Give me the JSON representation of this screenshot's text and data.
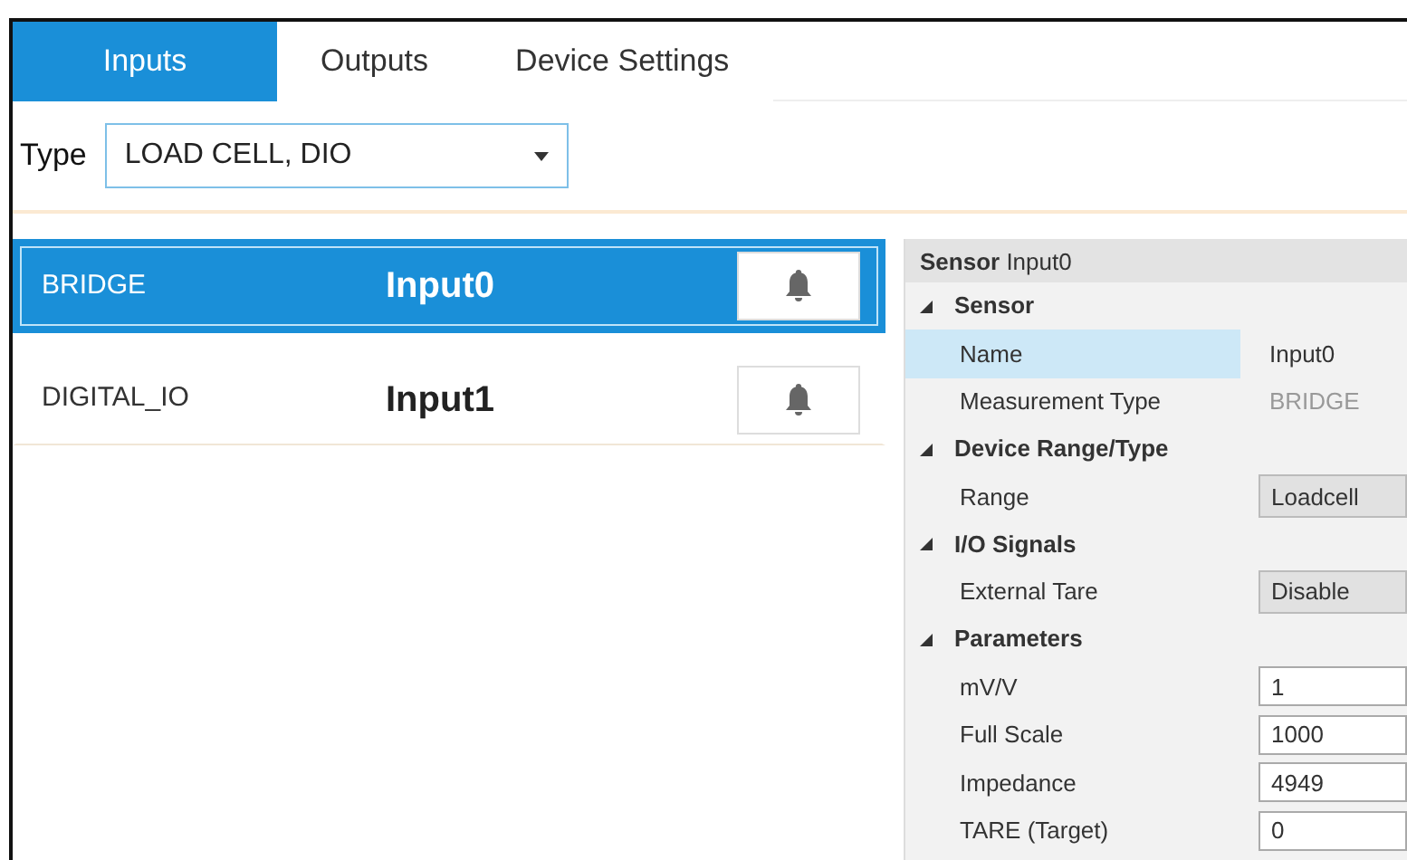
{
  "tabs": [
    {
      "label": "Inputs",
      "selected": true
    },
    {
      "label": "Outputs",
      "selected": false
    },
    {
      "label": "Device Settings",
      "selected": false
    }
  ],
  "type_filter": {
    "label": "Type",
    "value": "LOAD CELL, DIO"
  },
  "inputs": [
    {
      "type": "BRIDGE",
      "name": "Input0",
      "selected": true
    },
    {
      "type": "DIGITAL_IO",
      "name": "Input1",
      "selected": false
    }
  ],
  "properties": {
    "title": "**Sensor** Input0",
    "categories": [
      {
        "label": "Sensor",
        "expanded": true,
        "rows": [
          {
            "label": "Name",
            "value": "Input0",
            "kind": "text",
            "selected": true
          },
          {
            "label": "Measurement Type",
            "value": "BRIDGE",
            "kind": "readonly",
            "selected": false
          }
        ]
      },
      {
        "label": "Device Range/Type",
        "expanded": true,
        "rows": [
          {
            "label": "Range",
            "value": "Loadcell",
            "kind": "select",
            "selected": false
          }
        ]
      },
      {
        "label": "I/O Signals",
        "expanded": true,
        "rows": [
          {
            "label": "External Tare",
            "value": "Disable",
            "kind": "select",
            "selected": false
          }
        ]
      },
      {
        "label": "Parameters",
        "expanded": true,
        "rows": [
          {
            "label": "mV/V",
            "value": "1",
            "kind": "textbox",
            "selected": false
          },
          {
            "label": "Full Scale",
            "value": "1000",
            "kind": "textbox",
            "selected": false
          },
          {
            "label": "Impedance",
            "value": "4949",
            "kind": "textbox",
            "selected": false
          },
          {
            "label": "TARE (Target)",
            "value": "0",
            "kind": "textbox",
            "selected": false
          }
        ]
      }
    ]
  }
}
